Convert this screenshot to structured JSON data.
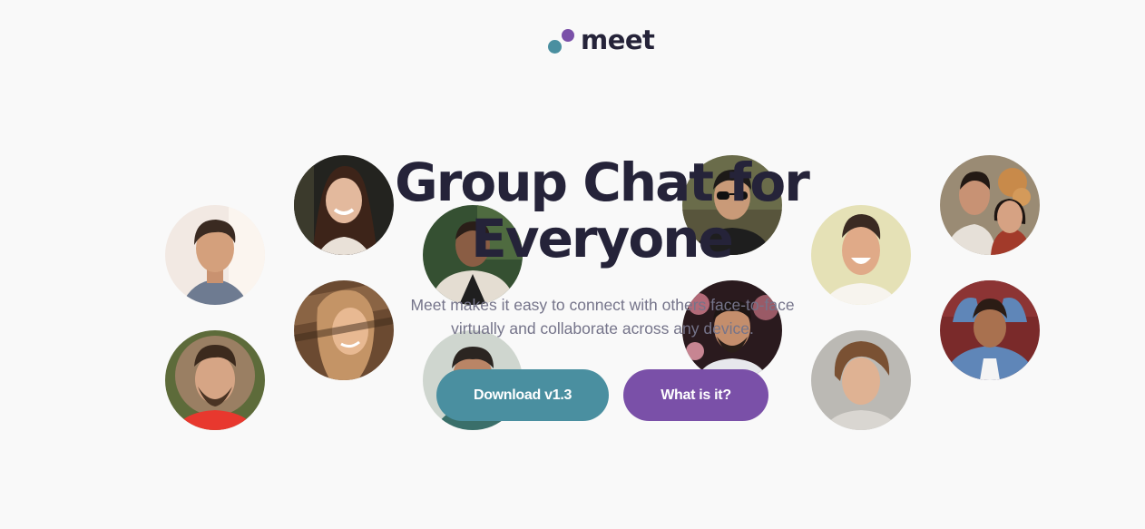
{
  "logo": {
    "text": "meet",
    "colors": {
      "dot_left": "#4a8fa0",
      "dot_right": "#7a50a8",
      "text": "#252339"
    }
  },
  "hero": {
    "title": "Group Chat for Everyone",
    "subtitle": "Meet makes it easy to connect with others face-to-face virtually and collaborate across any device."
  },
  "buttons": {
    "download": {
      "label": "Download v1.3",
      "color": "#4a8fa0"
    },
    "what_is_it": {
      "label": "What is it?",
      "color": "#7a50a8"
    }
  },
  "avatars": [
    {
      "name": "avatar-young-man-sunset"
    },
    {
      "name": "avatar-curly-hair-man-fur-hood"
    },
    {
      "name": "avatar-smiling-woman-dark-hair"
    },
    {
      "name": "avatar-woman-blonde-shadows"
    },
    {
      "name": "avatar-man-fur-jacket"
    },
    {
      "name": "avatar-older-man"
    },
    {
      "name": "avatar-man-sunglasses"
    },
    {
      "name": "avatar-man-beard-flowers"
    },
    {
      "name": "avatar-laughing-man"
    },
    {
      "name": "avatar-man-wavy-hair"
    },
    {
      "name": "avatar-couple"
    },
    {
      "name": "avatar-woman-denim-jacket"
    }
  ],
  "colors": {
    "background": "#f9f9f9",
    "heading": "#252339",
    "body_text": "#75748a"
  }
}
